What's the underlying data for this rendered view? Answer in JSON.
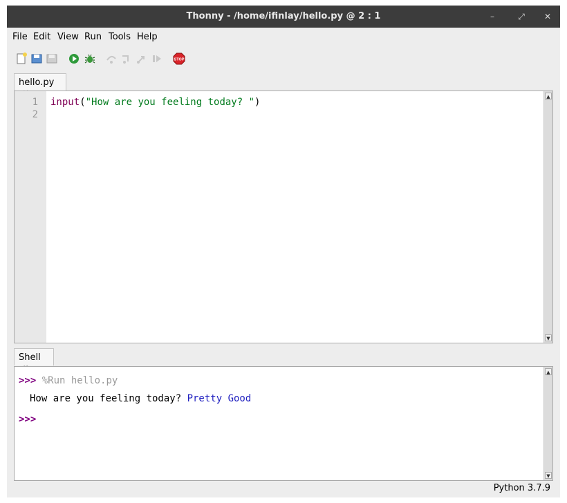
{
  "window": {
    "title": "Thonny  -  /home/ifinlay/hello.py  @  2 : 1",
    "controls": [
      "minimize",
      "maximize",
      "close"
    ]
  },
  "menubar": {
    "items": [
      "File",
      "Edit",
      "View",
      "Run",
      "Tools",
      "Help"
    ]
  },
  "toolbar": {
    "buttons": [
      "new-file-icon",
      "open-file-icon",
      "save-file-icon",
      "run-icon",
      "debug-icon",
      "step-over-icon",
      "step-into-icon",
      "step-out-icon",
      "resume-icon",
      "stop-icon"
    ],
    "stop_label": "STOP"
  },
  "editor": {
    "tab_label": "hello.py",
    "line_numbers": [
      "1",
      "2"
    ],
    "code": {
      "func": "input",
      "open_paren": "(",
      "string": "\"How are you feeling today? \"",
      "close_paren": ")"
    }
  },
  "shell": {
    "tab_label": "Shell",
    "prompt": ">>>",
    "command": "%Run hello.py",
    "output_prompt": "How are you feeling today? ",
    "output_input": "Pretty Good"
  },
  "status": {
    "interpreter": "Python 3.7.9"
  },
  "colors": {
    "keyword": "#7f0055",
    "string": "#007a1c",
    "prompt": "#7f007f",
    "user_input": "#1f1fbf",
    "command": "#9a9a9a"
  }
}
